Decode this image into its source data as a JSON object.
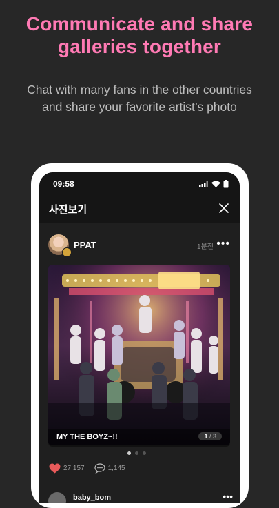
{
  "promo": {
    "title_line1": "Communicate and share",
    "title_line2": "galleries together",
    "subtitle_line1": "Chat with many fans in the other countries",
    "subtitle_line2": "and share your favorite artist’s photo"
  },
  "status_bar": {
    "time": "09:58"
  },
  "app_bar": {
    "title": "사진보기"
  },
  "post": {
    "username": "PPAT",
    "time_ago": "1분전",
    "caption": "MY THE BOYZ~!!",
    "page_current": "1",
    "page_total": "3",
    "like_count": "27,157",
    "comment_count": "1,145"
  },
  "next_post": {
    "username": "baby_bom"
  },
  "colors": {
    "accent_pink": "#ff7ab4",
    "like_red": "#e85a5a",
    "background": "#272727"
  },
  "icons": [
    "close-icon",
    "more-icon",
    "heart-icon",
    "comment-icon",
    "signal-icon",
    "wifi-icon",
    "battery-icon"
  ]
}
